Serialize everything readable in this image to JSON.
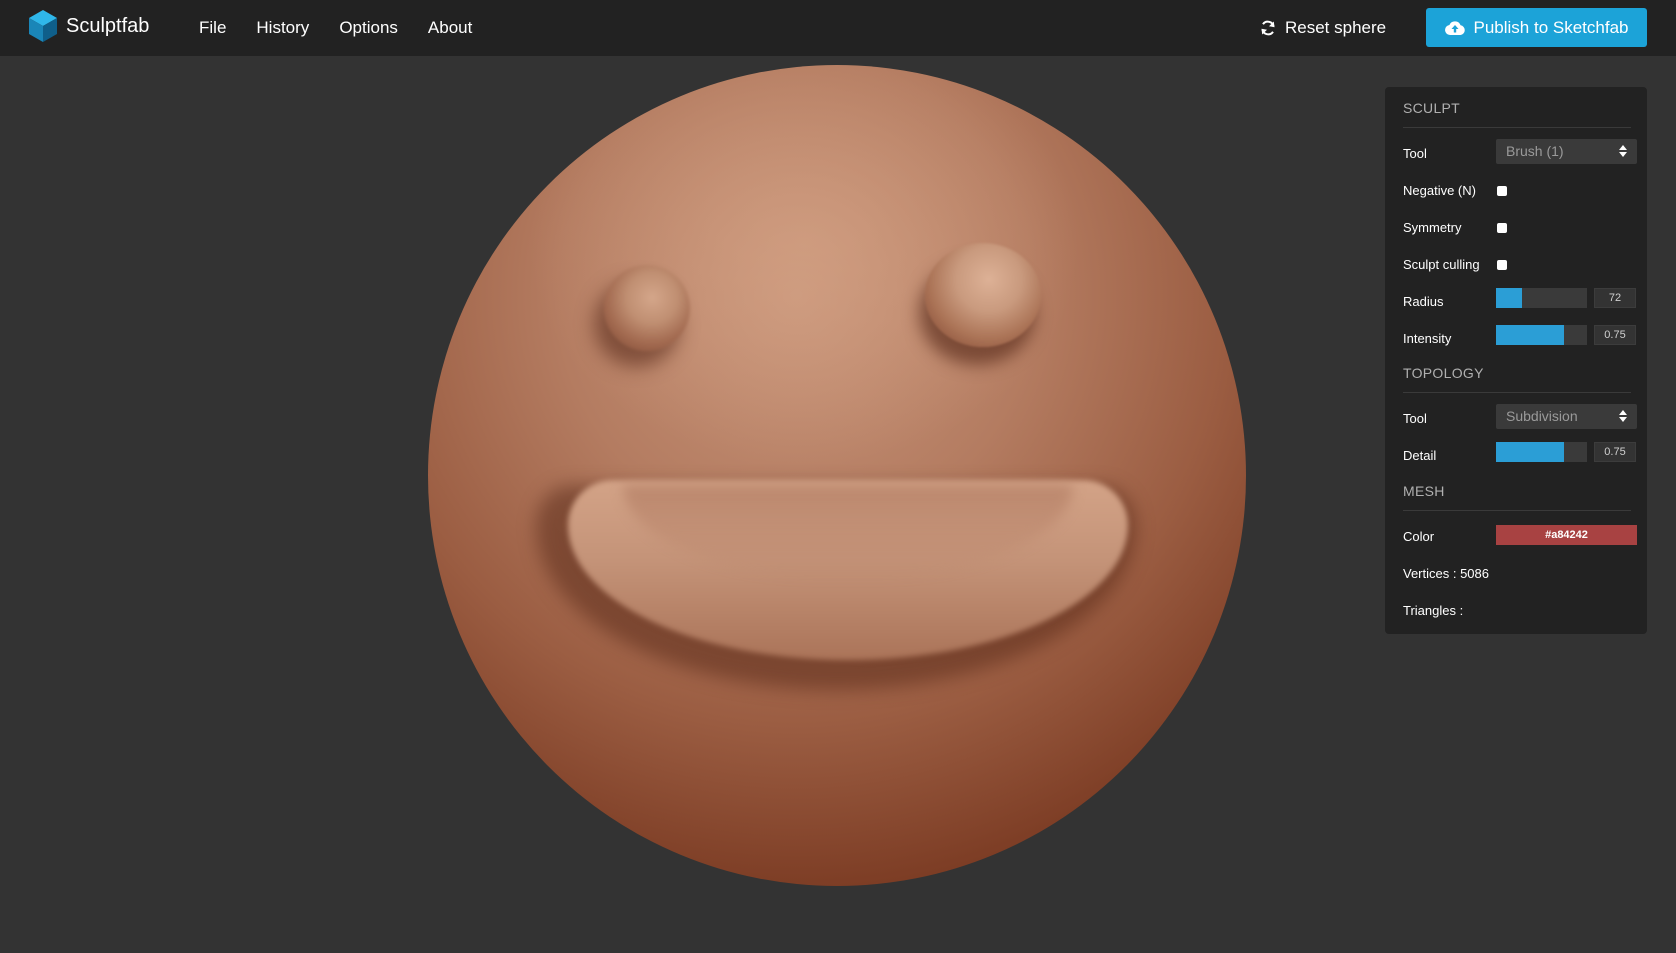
{
  "app": {
    "name": "Sculptfab"
  },
  "menu": {
    "items": [
      "File",
      "History",
      "Options",
      "About"
    ]
  },
  "toolbar": {
    "reset_label": "Reset sphere",
    "publish_label": "Publish to Sketchfab"
  },
  "panel": {
    "sculpt": {
      "title": "SCULPT",
      "tool": {
        "label": "Tool",
        "value": "Brush (1)"
      },
      "negative": {
        "label": "Negative (N)",
        "checked": false
      },
      "symmetry": {
        "label": "Symmetry",
        "checked": false
      },
      "culling": {
        "label": "Sculpt culling",
        "checked": false
      },
      "radius": {
        "label": "Radius",
        "value": "72",
        "fill": 0.29
      },
      "intensity": {
        "label": "Intensity",
        "value": "0.75",
        "fill": 0.75
      }
    },
    "topology": {
      "title": "TOPOLOGY",
      "tool": {
        "label": "Tool",
        "value": "Subdivision"
      },
      "detail": {
        "label": "Detail",
        "value": "0.75",
        "fill": 0.75
      }
    },
    "mesh": {
      "title": "MESH",
      "color": {
        "label": "Color",
        "value": "#a84242"
      },
      "vertices": "Vertices : 5086",
      "triangles": "Triangles :"
    }
  },
  "colors": {
    "accent": "#1ca3d8",
    "slider": "#2b9ed6",
    "mesh": "#a84242",
    "topbar": "#222222",
    "background": "#333333"
  },
  "icons": [
    "sculptfab-logo-icon",
    "refresh-icon",
    "cloud-upload-icon",
    "select-arrows-icon"
  ]
}
